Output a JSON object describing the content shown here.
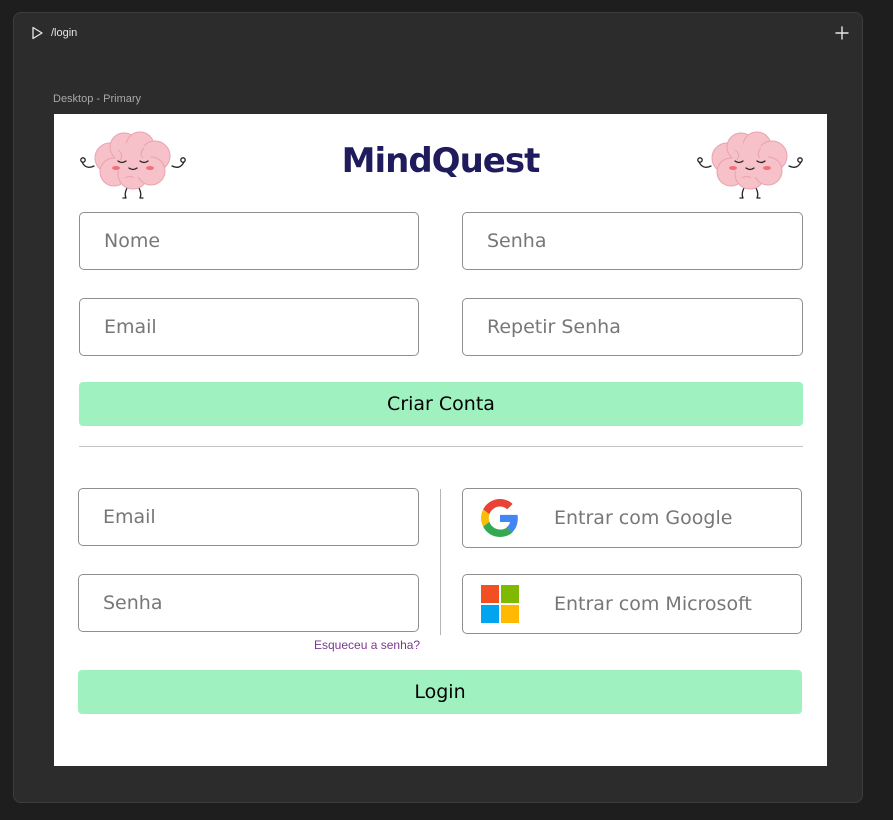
{
  "toolbar": {
    "route": "/login"
  },
  "frame": {
    "label": "Desktop - Primary"
  },
  "app": {
    "logo": "MindQuest"
  },
  "signup": {
    "name_placeholder": "Nome",
    "email_placeholder": "Email",
    "password_placeholder": "Senha",
    "repeat_password_placeholder": "Repetir Senha",
    "create_button": "Criar Conta"
  },
  "login": {
    "email_placeholder": "Email",
    "password_placeholder": "Senha",
    "forgot_link": "Esqueceu a senha?",
    "login_button": "Login",
    "google_button": "Entrar com Google",
    "microsoft_button": "Entrar com Microsoft"
  },
  "icons": {
    "play": "play-icon",
    "plus": "plus-icon",
    "brain": "brain-mascot-icon",
    "google": "google-icon",
    "microsoft": "microsoft-icon"
  },
  "colors": {
    "button_bg": "#a0f1c0",
    "logo": "#1f1b5c",
    "link": "#7a3a8a",
    "canvas_bg": "#2c2c2c"
  }
}
